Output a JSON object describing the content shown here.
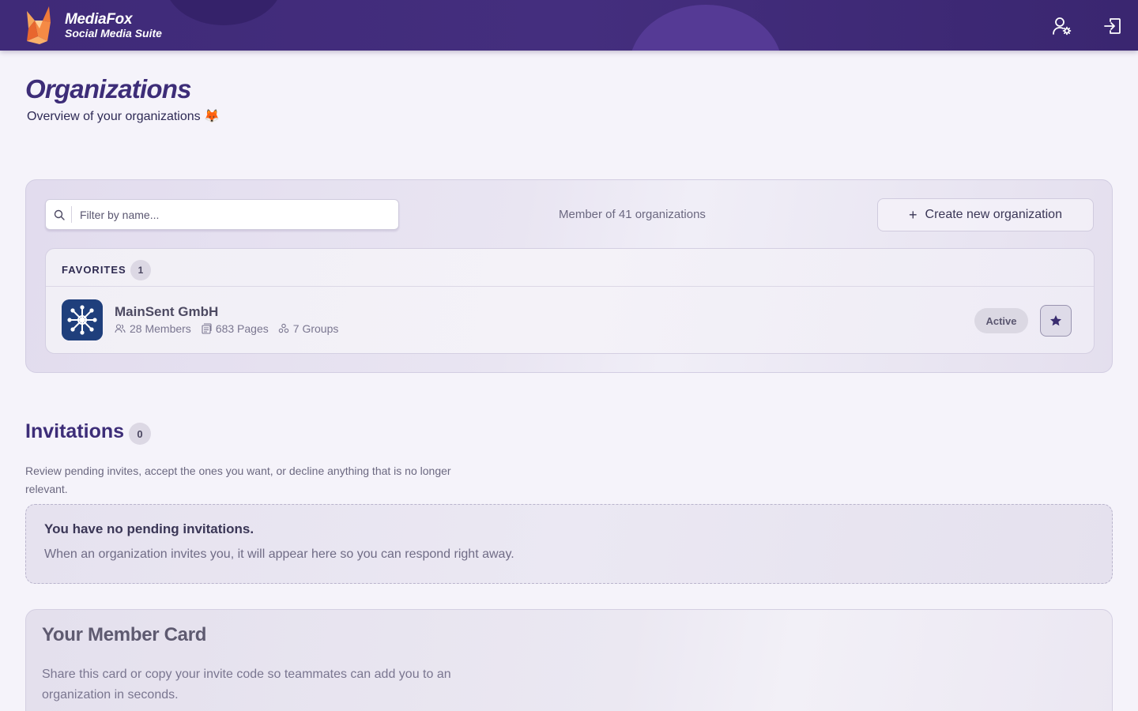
{
  "header": {
    "brand_title": "MediaFox",
    "brand_subtitle": "Social Media Suite",
    "icons": [
      "user-settings-icon",
      "logout-icon"
    ]
  },
  "page": {
    "title": "Organizations",
    "subtitle": "Overview of your organizations 🦊"
  },
  "organizations": {
    "search_placeholder": "Filter by name...",
    "search_value": "",
    "member_count_text": "Member of 41 organizations",
    "create_button_label": "Create new organization",
    "favorites": {
      "label": "FAVORITES",
      "count": "1",
      "items": [
        {
          "name": "MainSent GmbH",
          "members": "28 Members",
          "pages": "683 Pages",
          "groups": "7 Groups",
          "status": "Active",
          "favorite": true
        }
      ]
    }
  },
  "invitations": {
    "title": "Invitations",
    "count": "0",
    "description": "Review pending invites, accept the ones you want, or decline anything that is no longer relevant.",
    "empty_title": "You have no pending invitations.",
    "empty_text": "When an organization invites you, it will appear here so you can respond right away."
  },
  "member_card": {
    "title": "Your Member Card",
    "description": "Share this card or copy your invite code so teammates can add you to an organization in seconds."
  },
  "colors": {
    "header_bg": "#3f2a78",
    "accent": "#3d2d78",
    "org_logo_bg": "#1f3f7c"
  }
}
